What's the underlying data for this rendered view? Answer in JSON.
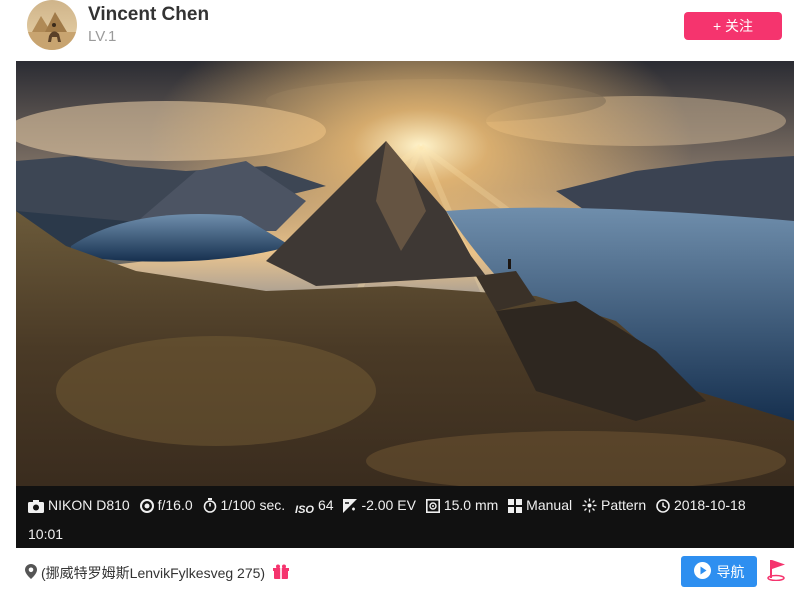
{
  "user": {
    "name": "Vincent Chen",
    "level": "LV.1",
    "follow_label": "+ 关注"
  },
  "exif": {
    "camera": "NIKON D810",
    "aperture": "f/16.0",
    "shutter": "1/100 sec.",
    "iso_label": "ISO",
    "iso": "64",
    "exposure": "-2.00 EV",
    "focal": "15.0 mm",
    "mode": "Manual",
    "metering": "Pattern",
    "datetime_date": "2018-10-18",
    "datetime_time": "10:01"
  },
  "location": {
    "text": "(挪威特罗姆斯LenvikFylkesveg 275)"
  },
  "nav": {
    "label": "导航"
  },
  "colors": {
    "follow": "#f5346e",
    "nav": "#2e8ff0",
    "exif_bg": "#111111"
  }
}
